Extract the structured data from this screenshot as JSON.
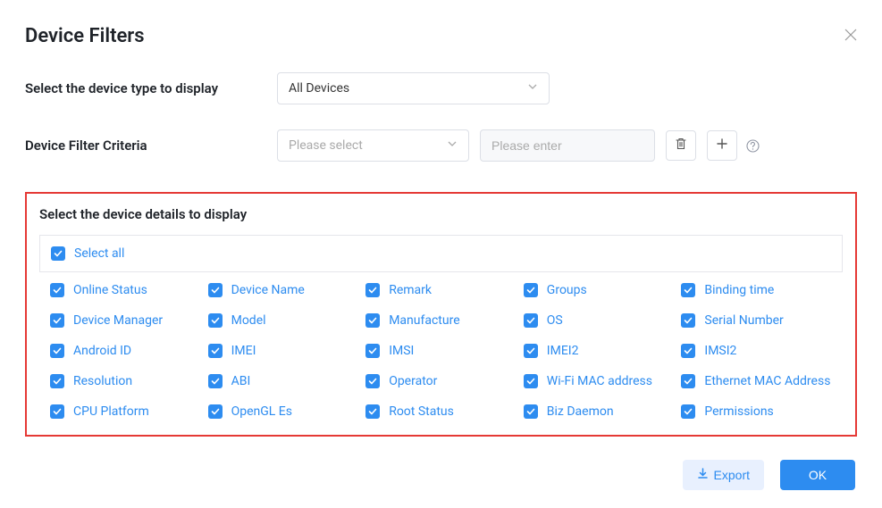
{
  "title": "Device Filters",
  "device_type": {
    "label": "Select the device type to display",
    "selected": "All Devices"
  },
  "criteria": {
    "label": "Device Filter Criteria",
    "select_placeholder": "Please select",
    "input_placeholder": "Please enter"
  },
  "details": {
    "label": "Select the device details to display",
    "select_all_label": "Select all",
    "items": [
      "Online Status",
      "Device Name",
      "Remark",
      "Groups",
      "Binding time",
      "Device Manager",
      "Model",
      "Manufacture",
      "OS",
      "Serial Number",
      "Android ID",
      "IMEI",
      "IMSI",
      "IMEI2",
      "IMSI2",
      "Resolution",
      "ABI",
      "Operator",
      "Wi-Fi MAC address",
      "Ethernet MAC Address",
      "CPU Platform",
      "OpenGL Es",
      "Root Status",
      "Biz Daemon",
      "Permissions"
    ]
  },
  "footer": {
    "export_label": "Export",
    "ok_label": "OK"
  },
  "icons": {
    "close": "close-icon",
    "chevron_down": "chevron-down-icon",
    "trash": "trash-icon",
    "plus": "plus-icon",
    "help": "help-icon",
    "download": "download-icon",
    "check": "check-icon"
  },
  "colors": {
    "primary": "#2d8cf0",
    "highlight_border": "#e53935",
    "border": "#dcdfe6",
    "placeholder": "#aaa",
    "text": "#1f2329"
  }
}
